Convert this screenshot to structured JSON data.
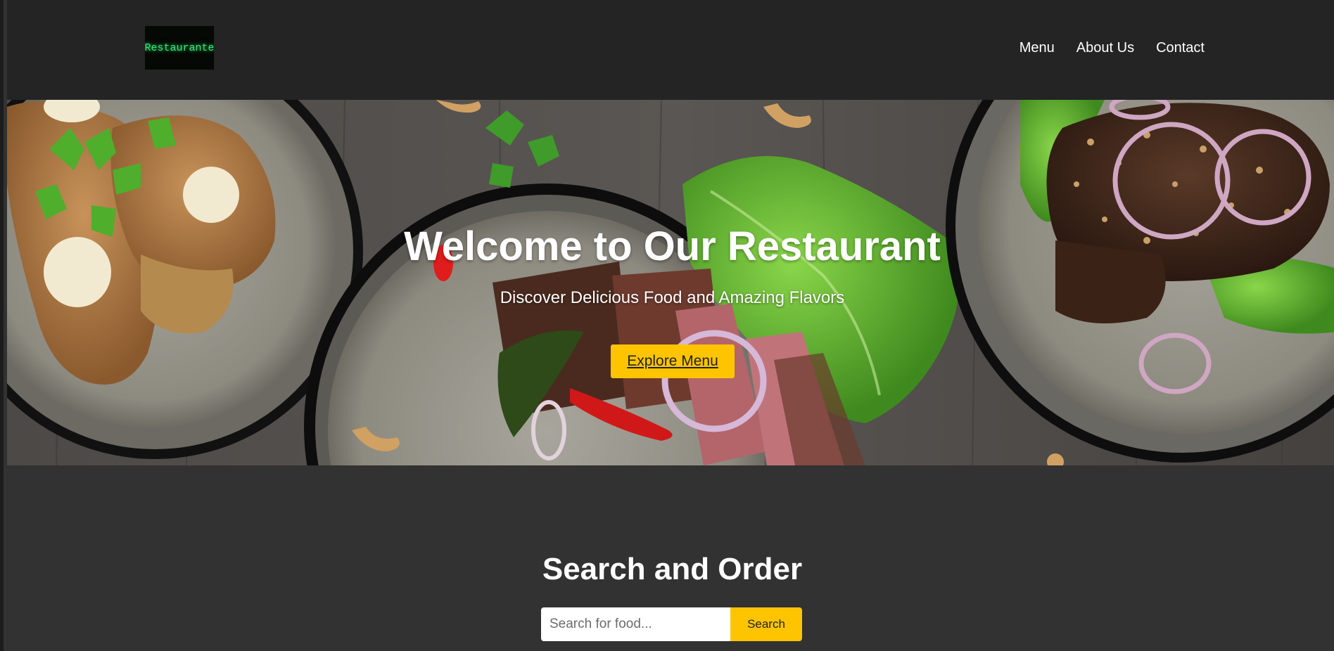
{
  "header": {
    "logo_text": "Restaurante",
    "nav": [
      {
        "label": "Menu"
      },
      {
        "label": "About Us"
      },
      {
        "label": "Contact"
      }
    ]
  },
  "hero": {
    "title": "Welcome to Our Restaurant",
    "subtitle": "Discover Delicious Food and Amazing Flavors",
    "cta_label": "Explore Menu"
  },
  "search": {
    "title": "Search and Order",
    "placeholder": "Search for food...",
    "button_label": "Search"
  },
  "colors": {
    "header_bg": "#242424",
    "page_bg": "#323232",
    "accent": "#ffc400",
    "logo_text": "#3ae47a"
  }
}
